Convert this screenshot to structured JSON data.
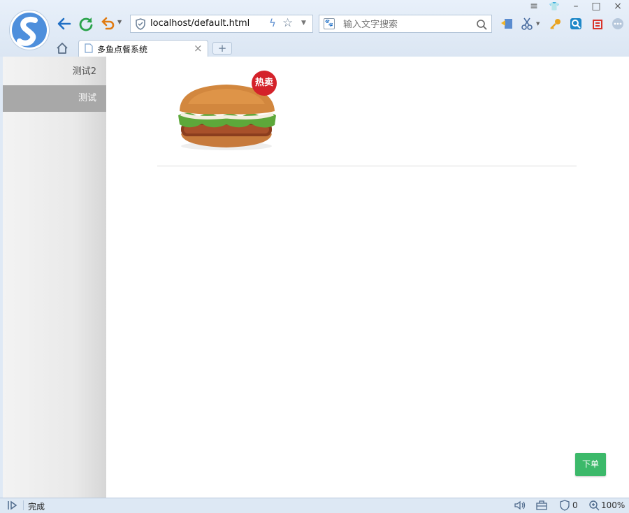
{
  "browser": {
    "address": "localhost/default.html",
    "search_placeholder": "输入文字搜索",
    "tab_title": "多鱼点餐系统",
    "new_tab_label": "+",
    "tab_close_label": "×"
  },
  "window_controls": [
    "≡",
    "👕",
    "–",
    "□",
    "×"
  ],
  "sidebar": {
    "items": [
      {
        "label": "测试2",
        "active": false
      },
      {
        "label": "测试",
        "active": true
      }
    ]
  },
  "product": {
    "badge": "热卖",
    "image": "hamburger"
  },
  "order_button": "下单",
  "status_bar": {
    "status": "完成",
    "security_count": "0",
    "zoom": "100%"
  },
  "colors": {
    "order_button": "#3cb96a",
    "badge": "#d4222a",
    "sidebar_active": "#a8a8a8"
  }
}
